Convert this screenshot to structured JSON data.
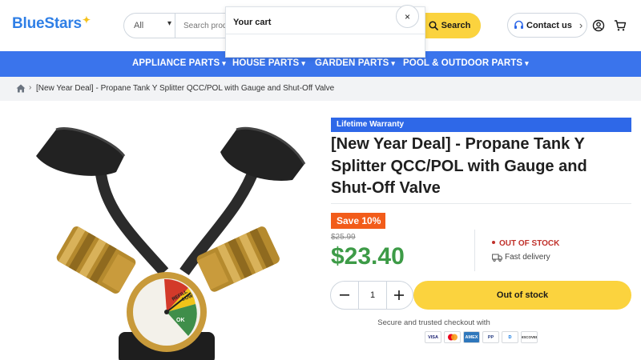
{
  "brand": {
    "name": "BlueStars",
    "accent": "#2f7fe6",
    "star_color": "#f5c21b"
  },
  "search": {
    "category": "All",
    "placeholder": "Search product",
    "button_label": "Search"
  },
  "header": {
    "contact_label": "Contact us",
    "icons": [
      "headset-icon",
      "account-icon",
      "cart-icon"
    ]
  },
  "cart_popover": {
    "title": "Your cart",
    "close_glyph": "×"
  },
  "nav": {
    "items": [
      {
        "label": "APPLIANCE PARTS"
      },
      {
        "label": "HOUSE PARTS"
      },
      {
        "label": "GARDEN PARTS"
      },
      {
        "label": "POOL & OUTDOOR PARTS"
      }
    ],
    "color": "#3a74ec"
  },
  "breadcrumb": {
    "current": "[New Year Deal] - Propane Tank Y Splitter QCC/POL with Gauge and Shut-Off Valve"
  },
  "product": {
    "warranty_badge": "Lifetime Warranty",
    "title": "[New Year Deal] - Propane Tank Y Splitter QCC/POL with Gauge and Shut-Off Valve",
    "save_badge": "Save 10%",
    "compare_price": "$25.99",
    "price": "$23.40",
    "stock_status": "OUT OF STOCK",
    "delivery": "Fast delivery",
    "quantity": "1",
    "cta_label": "Out of stock",
    "secure_text": "Secure and trusted checkout with",
    "payment_methods": [
      "VISA",
      "MC",
      "AMEX",
      "PP",
      "D",
      "DISCOVER"
    ],
    "gauge_labels": {
      "refill": "REFILL",
      "low": "LOW",
      "ok": "OK"
    }
  },
  "colors": {
    "price_green": "#3d9b47",
    "save_orange": "#f25c1a",
    "cta_yellow": "#fbd33e",
    "stock_red": "#c0302a"
  }
}
